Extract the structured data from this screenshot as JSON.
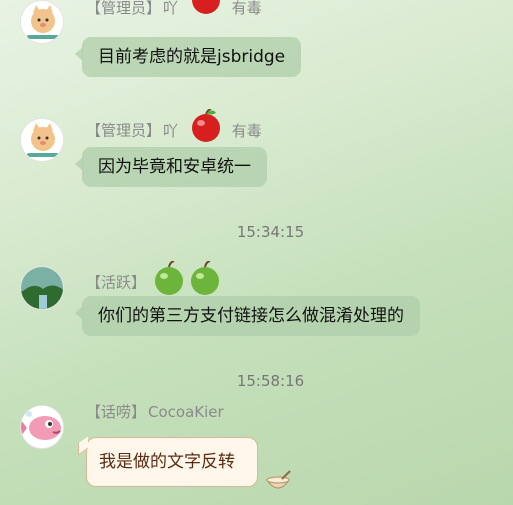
{
  "messages": [
    {
      "tag": "【管理员】",
      "name": "吖",
      "title": "有毒",
      "text": "目前考虑的就是jsbridge"
    },
    {
      "tag": "【管理员】",
      "name": "吖",
      "title": "有毒",
      "text": "因为毕竟和安卓统一"
    },
    {
      "time": "15:34:15",
      "tag": "【活跃】",
      "text": "你们的第三方支付链接怎么做混淆处理的"
    },
    {
      "time": "15:58:16",
      "tag": "【话唠】",
      "name": "CocoaKier",
      "text": "我是做的文字反转"
    }
  ],
  "colors": {
    "bubble": "#afcdaa",
    "meta_text": "#8a8a8a",
    "special_bubble_bg": "#fff8ea",
    "special_bubble_text": "#5b2a12"
  },
  "icons": [
    "cat-avatar-icon",
    "red-apple-icon",
    "green-apple-icon",
    "landscape-avatar-icon",
    "fish-avatar-icon",
    "bowl-icon"
  ]
}
